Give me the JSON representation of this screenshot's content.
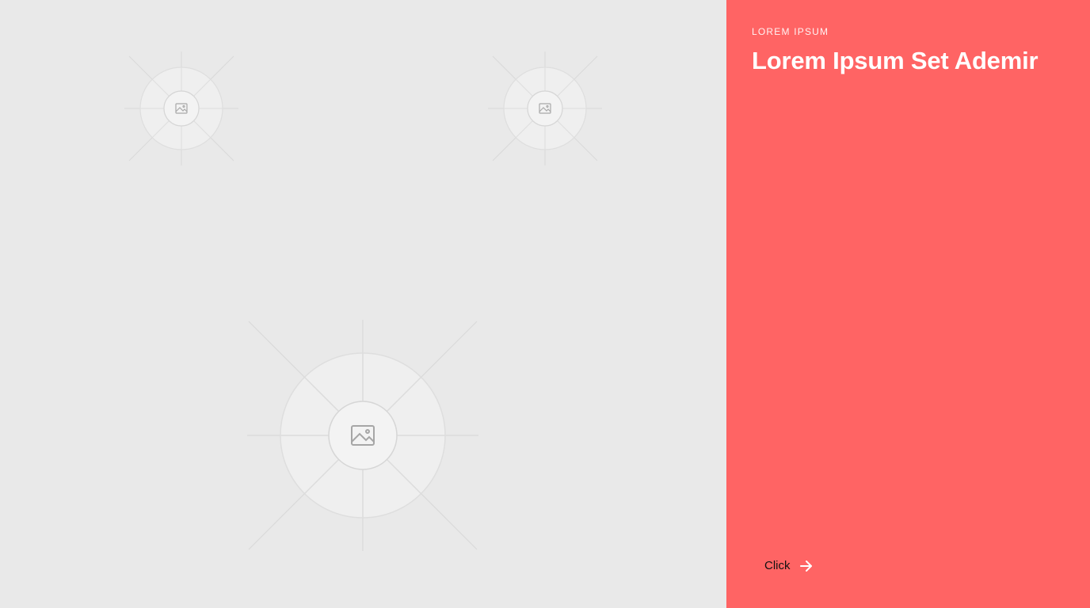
{
  "gallery": {
    "placeholders": [
      {
        "icon": "image-icon"
      },
      {
        "icon": "image-icon"
      },
      {
        "icon": "image-icon"
      }
    ]
  },
  "panel": {
    "eyebrow": "LOREM IPSUM",
    "title": "Lorem Ipsum Set Ademir",
    "cta_label": "Click",
    "cta_icon": "arrow-right-icon",
    "background_color": "#ff6464"
  }
}
